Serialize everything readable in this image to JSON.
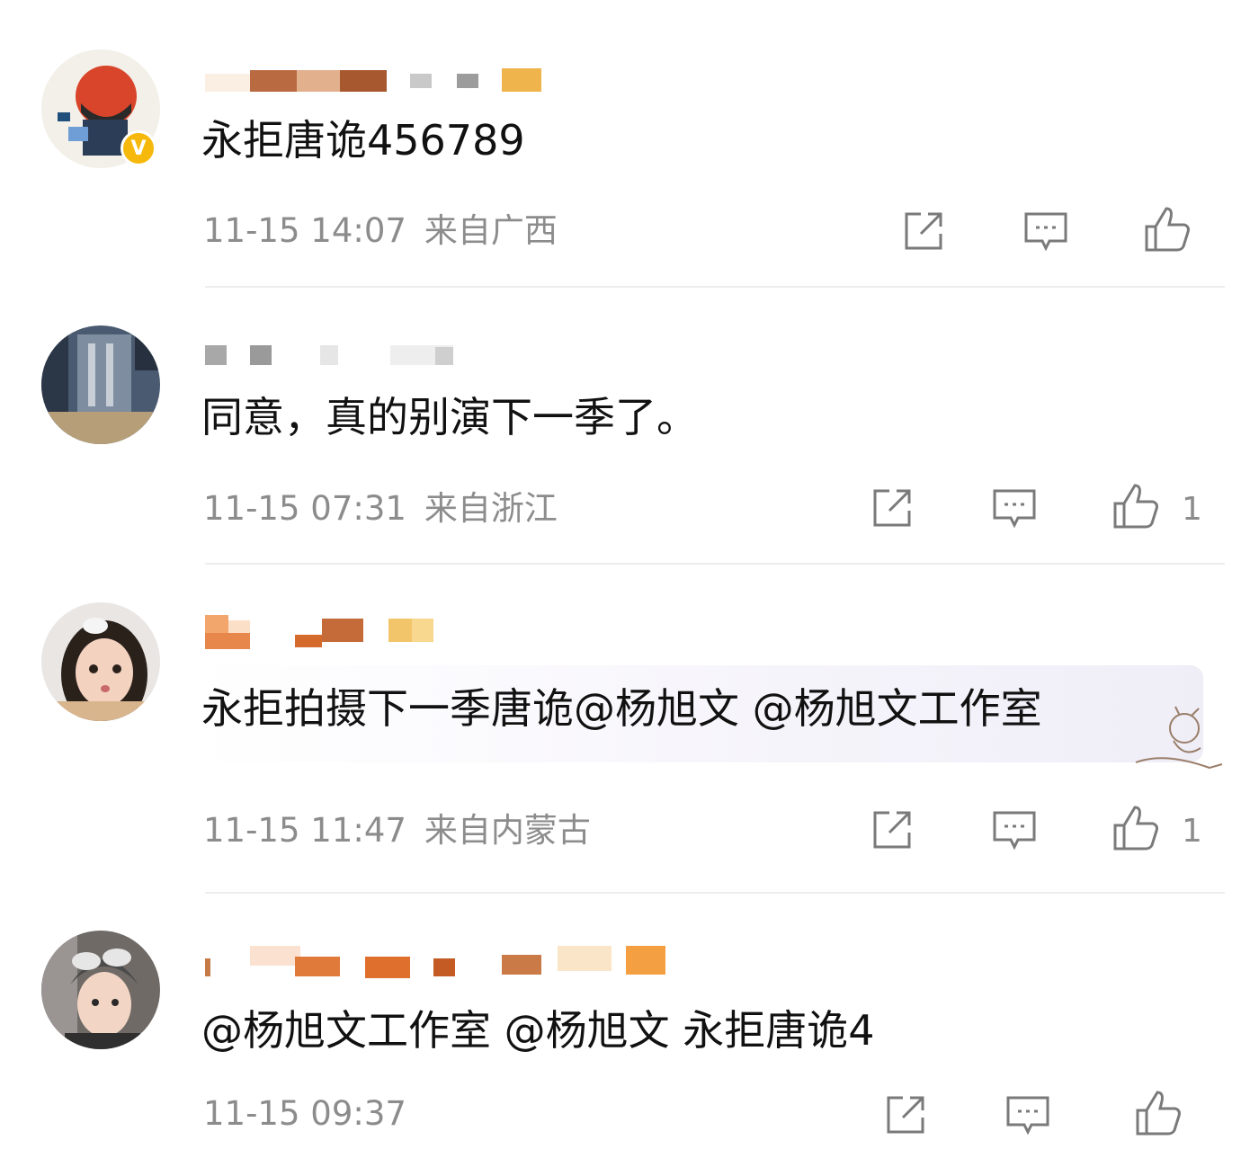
{
  "comments": [
    {
      "text": "永拒唐诡456789",
      "time": "11-15 14:07",
      "location": "来自广西",
      "like_count": "",
      "verified_badge": "V"
    },
    {
      "text": "同意，真的别演下一季了。",
      "time": "11-15 07:31",
      "location": "来自浙江",
      "like_count": "1"
    },
    {
      "text_plain": "永拒拍摄下一季唐诡",
      "mention1": "@杨旭文",
      "mention2": "@杨旭文工作室",
      "time": "11-15 11:47",
      "location": "来自内蒙古",
      "like_count": "1"
    },
    {
      "mention1": "@杨旭文工作室",
      "mention2": "@杨旭文",
      "text_plain": "永拒唐诡4",
      "time": "11-15 09:37",
      "location": "",
      "like_count": ""
    }
  ],
  "icons": {
    "share": "share-icon",
    "comment": "comment-icon",
    "like": "thumbs-up-icon"
  },
  "colors": {
    "meta_text": "#8c8c8c",
    "icon_stroke": "#7a7a7a",
    "badge": "#f6b80b"
  }
}
